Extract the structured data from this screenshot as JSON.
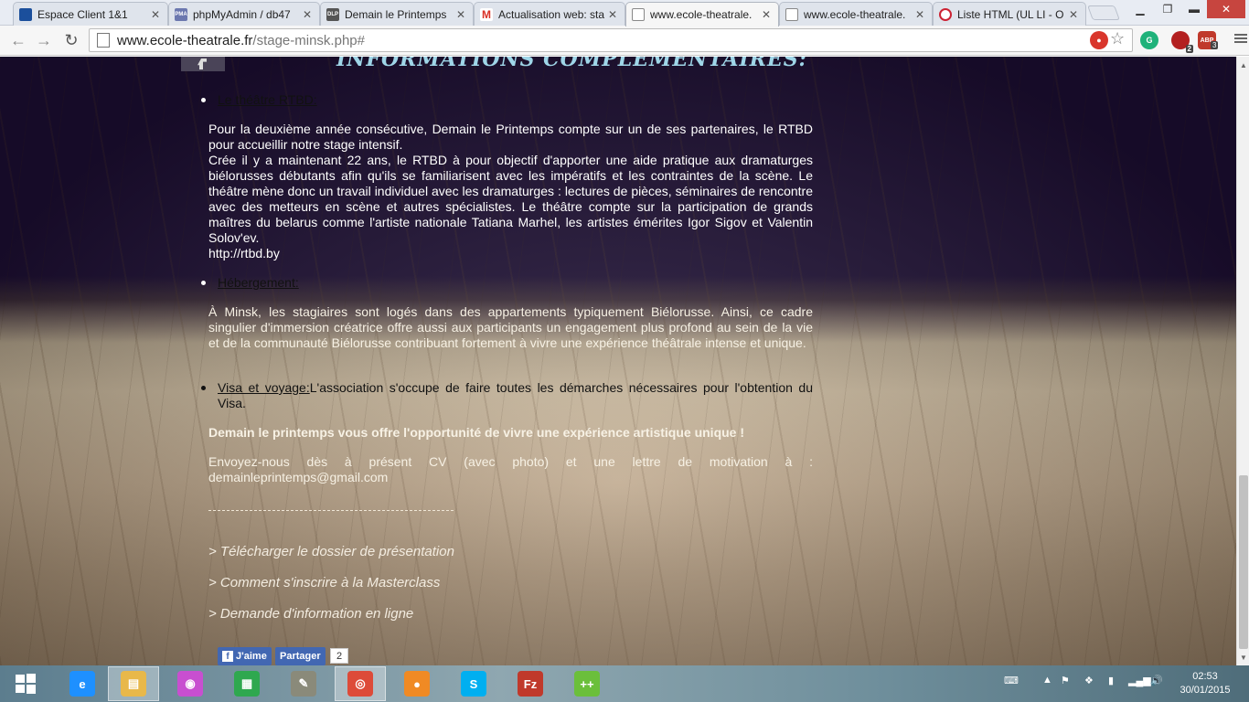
{
  "browser": {
    "tabs": [
      {
        "title": "Espace Client 1&1",
        "favicon": "1&1-icon",
        "fav_text": "",
        "fav_color": "#1b4f9c"
      },
      {
        "title": "phpMyAdmin / db47",
        "favicon": "phpmyadmin-icon",
        "fav_text": "PMA",
        "fav_color": "#6c78af"
      },
      {
        "title": "Demain le Printemps",
        "favicon": "dlp-icon",
        "fav_text": "DLP",
        "fav_color": "#555555"
      },
      {
        "title": "Actualisation web: sta",
        "favicon": "gmail-icon",
        "fav_text": "M",
        "fav_color": "#d93025"
      },
      {
        "title": "www.ecole-theatrale.",
        "favicon": "page-icon",
        "fav_text": "",
        "fav_color": "#ffffff"
      },
      {
        "title": "www.ecole-theatrale.",
        "favicon": "page-icon",
        "fav_text": "",
        "fav_color": "#ffffff"
      },
      {
        "title": "Liste HTML (UL LI - O",
        "favicon": "opera-icon",
        "fav_text": "",
        "fav_color": "#cc2233"
      }
    ],
    "active_tab_index": 4,
    "url_host": "www.ecole-theatrale.fr",
    "url_path": "/stage-minsk.php#",
    "extensions": [
      {
        "name": "lastpass-icon",
        "label": "",
        "color": "#d9362c"
      },
      {
        "name": "grammarly-icon",
        "label": "",
        "color": "#1fb27a"
      },
      {
        "name": "ublock-icon",
        "label": "2",
        "color": "#b32020"
      },
      {
        "name": "adblock-plus-icon",
        "label": "ABP",
        "color": "#c0392b"
      }
    ],
    "extension_badges": [
      "2",
      "3"
    ]
  },
  "page": {
    "section_title": "Informations complémentaires:",
    "items": [
      {
        "label": "Le théâtre RTBD:",
        "paragraphs": [
          "Pour la deuxième année consécutive, Demain le Printemps compte sur un de ses partenaires, le RTBD pour accueillir notre stage intensif.",
          "Crée il y a maintenant 22 ans, le RTBD à pour objectif d'apporter une aide pratique aux dramaturges biélorusses débutants afin qu'ils se familiarisent avec les impératifs et les contraintes de la scène. Le théâtre mène donc un travail individuel avec les dramaturges : lectures de pièces, séminaires de rencontre avec des metteurs en scène et autres spécialistes. Le théâtre compte sur la participation de grands maîtres du belarus comme l'artiste nationale Tatiana Marhel, les artistes émérites Igor Sigov et Valentin Solov'ev.",
          "http://rtbd.by"
        ]
      },
      {
        "label": "Hébergement:",
        "paragraphs": [
          "À Minsk, les stagiaires sont logés dans des appartements typiquement Biélorusse. Ainsi, ce cadre singulier d'immersion créatrice offre aussi aux participants un engagement plus profond au sein de la vie et de la communauté Biélorusse contribuant fortement à vivre une expérience théâtrale intense et unique."
        ]
      },
      {
        "label": "Visa et voyage:",
        "text": "L'association s'occupe de faire toutes les démarches nécessaires pour l'obtention du Visa."
      }
    ],
    "highlight": "Demain le printemps vous offre l'opportunité de vivre une expérience artistique unique !",
    "contact": "Envoyez-nous dès à présent CV (avec photo) et une lettre de motivation à : demainleprintemps@gmail.com",
    "links": [
      "> Télécharger le dossier de présentation",
      "> Comment s'inscrire à la Masterclass",
      "> Demande d'information en ligne"
    ],
    "facebook": {
      "like_label": "J'aime",
      "share_label": "Partager",
      "count": "2"
    }
  },
  "taskbar": {
    "apps": [
      {
        "name": "internet-explorer-icon",
        "glyph": "e",
        "color": "#1e90ff",
        "active": false
      },
      {
        "name": "file-explorer-icon",
        "glyph": "▤",
        "color": "#e8b84a",
        "active": true
      },
      {
        "name": "picasa-icon",
        "glyph": "◉",
        "color": "#c84fd0",
        "active": false
      },
      {
        "name": "windows-store-icon",
        "glyph": "▦",
        "color": "#2fa84f",
        "active": false
      },
      {
        "name": "notepad-icon",
        "glyph": "✎",
        "color": "#8a8a7a",
        "active": false
      },
      {
        "name": "chrome-icon",
        "glyph": "◎",
        "color": "#dd4b39",
        "active": true
      },
      {
        "name": "firefox-icon",
        "glyph": "●",
        "color": "#f08a24",
        "active": false
      },
      {
        "name": "skype-icon",
        "glyph": "S",
        "color": "#00aff0",
        "active": false
      },
      {
        "name": "filezilla-icon",
        "glyph": "Fz",
        "color": "#c0392b",
        "active": false
      },
      {
        "name": "notepad-plus-plus-icon",
        "glyph": "++",
        "color": "#6bbf3b",
        "active": false
      }
    ],
    "time": "02:53",
    "date": "30/01/2015"
  }
}
